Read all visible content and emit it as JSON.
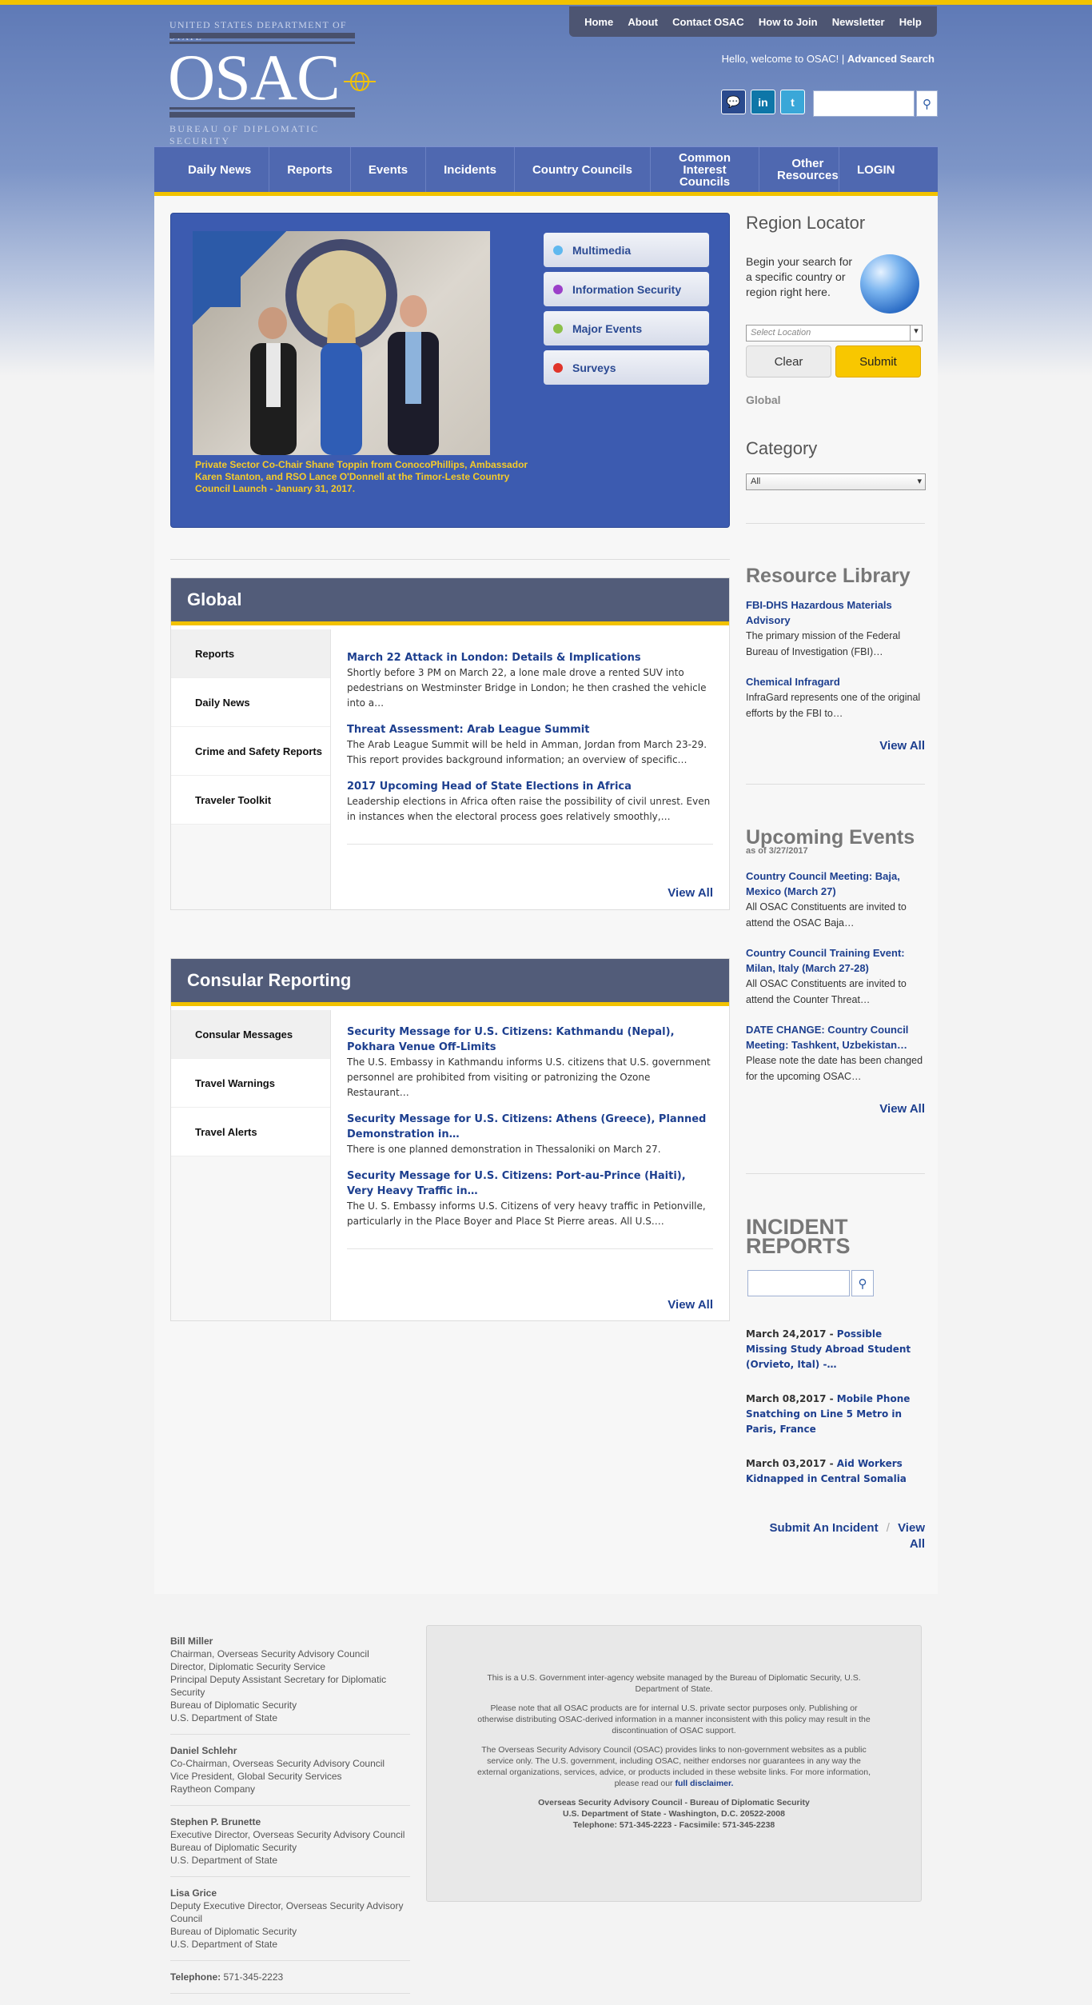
{
  "top_nav": [
    "Home",
    "About",
    "Contact OSAC",
    "How to Join",
    "Newsletter",
    "Help"
  ],
  "logo": {
    "line1": "UNITED STATES DEPARTMENT OF STATE",
    "name": "OSAC",
    "line2": "BUREAU OF DIPLOMATIC SECURITY"
  },
  "welcome": {
    "text": "Hello, welcome to OSAC! |",
    "advanced": "Advanced Search"
  },
  "social": {
    "linkedin": "in",
    "twitter": "t",
    "chat": "💬"
  },
  "main_nav": [
    "Daily News",
    "Reports",
    "Events",
    "Incidents",
    "Country Councils",
    "Common Interest Councils",
    "Other Resources",
    "LOGIN"
  ],
  "slider": {
    "caption": "Private Sector Co-Chair Shane Toppin from ConocoPhillips, Ambassador Karen Stanton, and RSO Lance O'Donnell at the Timor-Leste Country Council Launch - January 31, 2017.",
    "tabs": [
      {
        "label": "Multimedia",
        "color": "#5fb8ef"
      },
      {
        "label": "Information Security",
        "color": "#9b3fc9"
      },
      {
        "label": "Major Events",
        "color": "#8cc04a"
      },
      {
        "label": "Surveys",
        "color": "#e0342a"
      }
    ]
  },
  "region": {
    "title": "Region Locator",
    "text": "Begin your search for a specific country or region right here.",
    "select_placeholder": "Select Location",
    "clear": "Clear",
    "submit": "Submit",
    "global": "Global"
  },
  "category": {
    "title": "Category",
    "selected": "All"
  },
  "global_box": {
    "title": "Global",
    "tabs": [
      "Reports",
      "Daily News",
      "Crime and Safety Reports",
      "Traveler Toolkit"
    ],
    "articles": [
      {
        "title": "March 22 Attack in London: Details & Implications",
        "desc": "Shortly before 3 PM on March 22, a lone male drove a rented SUV into pedestrians on Westminster Bridge in London; he then crashed the vehicle into a…"
      },
      {
        "title": "Threat Assessment: Arab League Summit",
        "desc": "The Arab League Summit will be held in Amman, Jordan from March 23-29. This report provides background information; an overview of specific…"
      },
      {
        "title": "2017 Upcoming Head of State Elections in Africa",
        "desc": "Leadership elections in Africa often raise the possibility of civil unrest. Even in instances when the electoral process goes relatively smoothly,…"
      }
    ],
    "view_all": "View All"
  },
  "consular_box": {
    "title": "Consular Reporting",
    "tabs": [
      "Consular Messages",
      "Travel Warnings",
      "Travel Alerts"
    ],
    "articles": [
      {
        "title": "Security Message for U.S. Citizens: Kathmandu (Nepal), Pokhara Venue Off-Limits",
        "desc": "The U.S. Embassy in Kathmandu informs U.S. citizens that U.S. government personnel are prohibited from visiting or patronizing the Ozone Restaurant…"
      },
      {
        "title": "Security Message for U.S. Citizens: Athens (Greece), Planned Demonstration in…",
        "desc": "There is one planned demonstration in Thessaloniki on March 27."
      },
      {
        "title": "Security Message for U.S. Citizens: Port-au-Prince (Haiti), Very Heavy Traffic in…",
        "desc": "The U. S. Embassy informs U.S. Citizens of very heavy traffic in Petionville, particularly in the Place Boyer and Place St Pierre areas. All U.S.…"
      }
    ],
    "view_all": "View All"
  },
  "resource_library": {
    "title": "Resource Library",
    "items": [
      {
        "title": "FBI-DHS Hazardous Materials Advisory",
        "desc": "The primary mission of the Federal Bureau of Investigation (FBI)…"
      },
      {
        "title": "Chemical Infragard",
        "desc": "InfraGard represents one of the original efforts by the FBI to…"
      }
    ],
    "view_all": "View All"
  },
  "upcoming_events": {
    "title": "Upcoming Events",
    "as_of": "as of 3/27/2017",
    "items": [
      {
        "title": "Country Council Meeting: Baja, Mexico (March 27)",
        "desc": "All OSAC Constituents are invited to attend the OSAC Baja…"
      },
      {
        "title": "Country Council Training Event: Milan, Italy (March 27-28)",
        "desc": "All OSAC Constituents are invited to attend the Counter Threat…"
      },
      {
        "title": "DATE CHANGE: Country Council Meeting: Tashkent, Uzbekistan…",
        "desc": "Please note the date has been changed for the upcoming OSAC…"
      }
    ],
    "view_all": "View All"
  },
  "incident_reports": {
    "title_line1": "INCIDENT",
    "title_line2": "REPORTS",
    "items": [
      {
        "date": "March 24,2017 -",
        "title": "Possible Missing Study Abroad Student (Orvieto, Ital) -…"
      },
      {
        "date": "March 08,2017 -",
        "title": "Mobile Phone Snatching on Line 5 Metro in Paris, France"
      },
      {
        "date": "March 03,2017 -",
        "title": "Aid Workers Kidnapped in Central Somalia"
      }
    ],
    "submit": "Submit An Incident",
    "sep": "/",
    "view_all": "View All"
  },
  "footer_people": [
    {
      "name": "Bill Miller",
      "lines": [
        "Chairman, Overseas Security Advisory Council",
        "Director, Diplomatic Security Service",
        "Principal Deputy Assistant Secretary for Diplomatic Security",
        "Bureau of Diplomatic Security",
        "U.S. Department of State"
      ]
    },
    {
      "name": "Daniel Schlehr",
      "lines": [
        "Co-Chairman, Overseas Security Advisory Council",
        "Vice President, Global Security Services",
        "Raytheon Company"
      ]
    },
    {
      "name": "Stephen P. Brunette",
      "lines": [
        "Executive Director, Overseas Security Advisory Council",
        "Bureau of Diplomatic Security",
        "U.S. Department of State"
      ]
    },
    {
      "name": "Lisa Grice",
      "lines": [
        "Deputy Executive Director, Overseas Security Advisory Council",
        "Bureau of Diplomatic Security",
        "U.S. Department of State"
      ]
    }
  ],
  "footer_phone": {
    "label": "Telephone:",
    "value": "571-345-2223"
  },
  "disclaimer": {
    "p1": "This is a U.S. Government inter-agency website managed by the Bureau of Diplomatic Security, U.S. Department of State.",
    "p2": "Please note that all OSAC products are for internal U.S. private sector purposes only. Publishing or otherwise distributing OSAC-derived information in a manner inconsistent with this policy may result in the discontinuation of OSAC support.",
    "p3": "The Overseas Security Advisory Council (OSAC) provides links to non-government websites as a public service only. The U.S. government, including OSAC, neither endorses nor guarantees in any way the external organizations, services, advice, or products included in these website links. For more information, please read our",
    "link": "full disclaimer.",
    "addr1": "Overseas Security Advisory Council - Bureau of Diplomatic Security",
    "addr2": "U.S. Department of State - Washington, D.C. 20522-2008",
    "addr3": "Telephone: 571-345-2223 - Facsimile: 571-345-2238"
  }
}
